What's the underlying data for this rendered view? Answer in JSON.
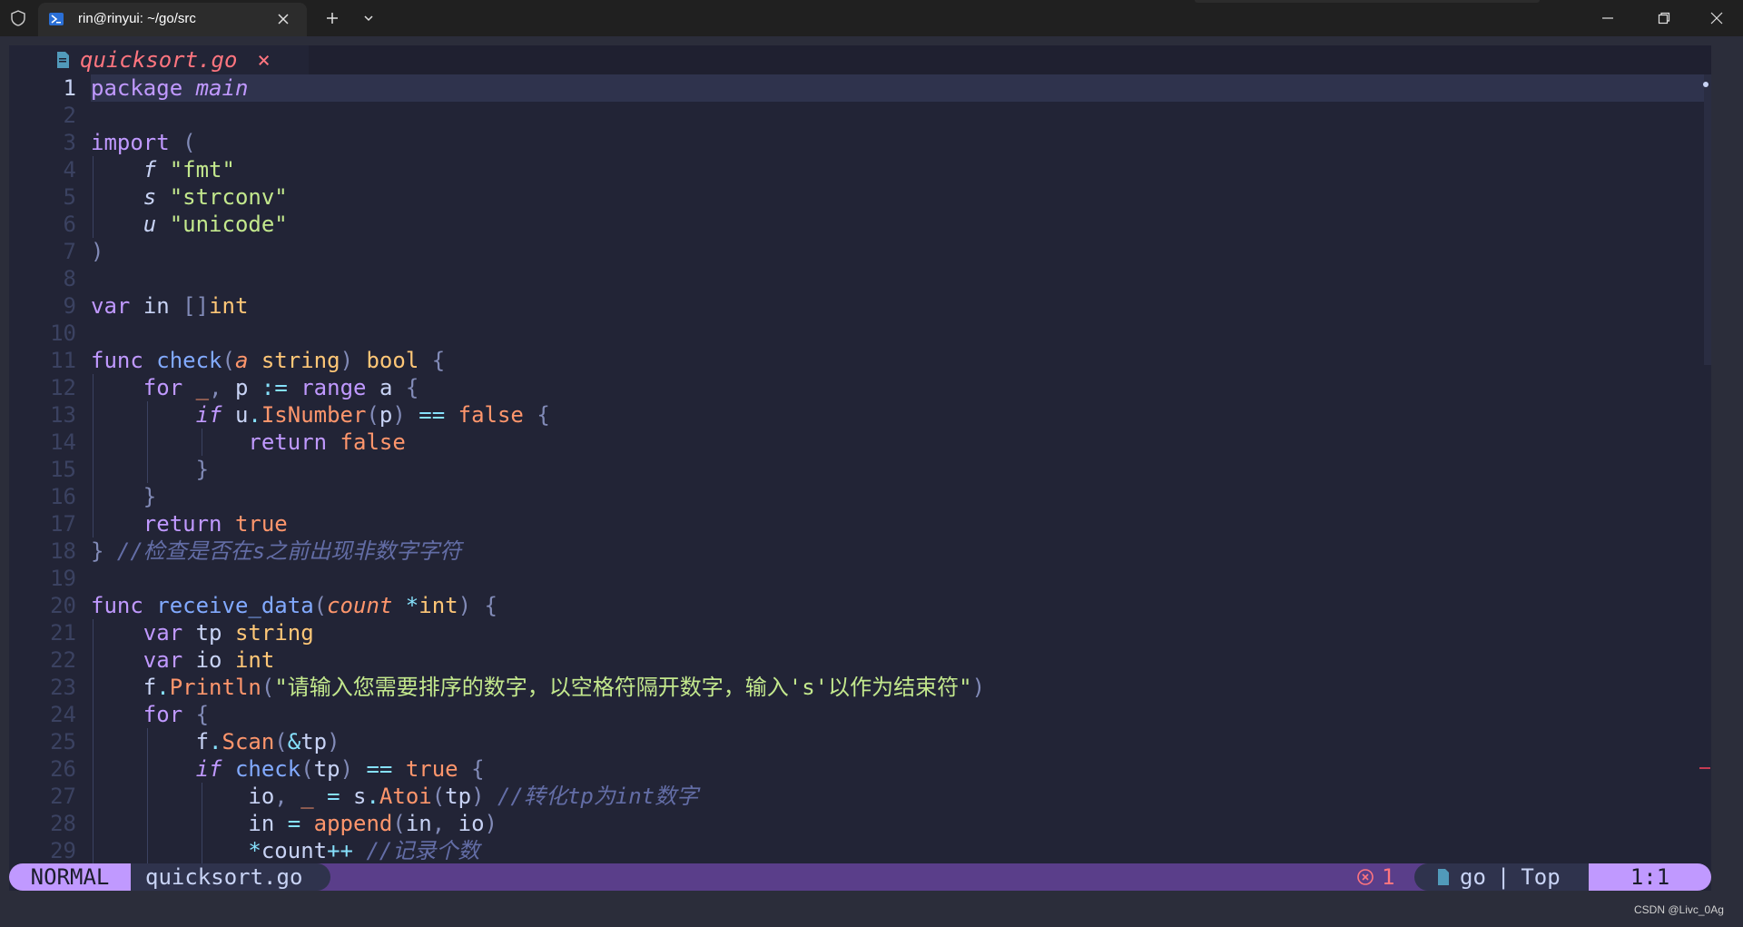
{
  "window": {
    "tab_title": "rin@rinyui: ~/go/src"
  },
  "buffer": {
    "file_name": "quicksort.go",
    "close_glyph": "×"
  },
  "line_numbers": [
    "1",
    "2",
    "3",
    "4",
    "5",
    "6",
    "7",
    "8",
    "9",
    "10",
    "11",
    "12",
    "13",
    "14",
    "15",
    "16",
    "17",
    "18",
    "19",
    "20",
    "21",
    "22",
    "23",
    "24",
    "25",
    "26",
    "27",
    "28",
    "29"
  ],
  "code": {
    "l1": {
      "a": "package",
      "b": "main"
    },
    "l3": {
      "a": "import",
      "b": "("
    },
    "l4": {
      "a": "f",
      "b": "\"fmt\""
    },
    "l5": {
      "a": "s",
      "b": "\"strconv\""
    },
    "l6": {
      "a": "u",
      "b": "\"unicode\""
    },
    "l7": {
      "a": ")"
    },
    "l9": {
      "a": "var",
      "b": "in",
      "c": "[]",
      "d": "int"
    },
    "l11": {
      "a": "func",
      "b": "check",
      "c": "(",
      "d": "a",
      "e": "string",
      "f": ")",
      "g": "bool",
      "h": "{"
    },
    "l12": {
      "a": "for",
      "b": "_",
      "c": ",",
      "d": "p",
      "e": ":=",
      "f": "range",
      "g": "a",
      "h": "{"
    },
    "l13": {
      "a": "if",
      "b": "u",
      "c": ".",
      "d": "IsNumber",
      "e": "(",
      "f": "p",
      "g": ")",
      "h": "==",
      "i": "false",
      "j": "{"
    },
    "l14": {
      "a": "return",
      "b": "false"
    },
    "l15": {
      "a": "}"
    },
    "l16": {
      "a": "}"
    },
    "l17": {
      "a": "return",
      "b": "true"
    },
    "l18": {
      "a": "}",
      "b": "//检查是否在s之前出现非数字字符"
    },
    "l20": {
      "a": "func",
      "b": "receive_data",
      "c": "(",
      "d": "count",
      "e": "*",
      "f": "int",
      "g": ")",
      "h": "{"
    },
    "l21": {
      "a": "var",
      "b": "tp",
      "c": "string"
    },
    "l22": {
      "a": "var",
      "b": "io",
      "c": "int"
    },
    "l23": {
      "a": "f",
      "b": ".",
      "c": "Println",
      "d": "(",
      "e": "\"请输入您需要排序的数字，以空格符隔开数字，输入's'以作为结束符\"",
      "f": ")"
    },
    "l24": {
      "a": "for",
      "b": "{"
    },
    "l25": {
      "a": "f",
      "b": ".",
      "c": "Scan",
      "d": "(",
      "e": "&",
      "f": "tp",
      "g": ")"
    },
    "l26": {
      "a": "if",
      "b": "check",
      "c": "(",
      "d": "tp",
      "e": ")",
      "f": "==",
      "g": "true",
      "h": "{"
    },
    "l27": {
      "a": "io",
      "b": ",",
      "c": "_",
      "d": "=",
      "e": "s",
      "f": ".",
      "g": "Atoi",
      "h": "(",
      "i": "tp",
      "j": ")",
      "k": "//转化tp为int数字"
    },
    "l28": {
      "a": "in",
      "b": "=",
      "c": "append",
      "d": "(",
      "e": "in",
      "f": ",",
      "g": "io",
      "h": ")"
    },
    "l29": {
      "a": "*",
      "b": "count",
      "c": "++",
      "d": "//记录个数"
    }
  },
  "statusline": {
    "mode": "NORMAL",
    "file": "quicksort.go",
    "errors": "1",
    "filetype": "go",
    "separator": "|",
    "scroll": "Top",
    "position": "1:1"
  },
  "watermark": "CSDN @Livc_0Ag",
  "colors": {
    "background": "#222436",
    "keyword": "#c099ff",
    "function": "#82aaff",
    "type": "#ffc777",
    "string": "#c3e88d",
    "comment": "#636da6",
    "accent": "#c099ff",
    "error": "#ff757f"
  },
  "icons": [
    "shield-icon",
    "powershell-icon",
    "close-icon",
    "plus-icon",
    "chevron-down-icon",
    "minimize-icon",
    "maximize-icon",
    "window-close-icon",
    "go-file-icon",
    "error-circle-icon"
  ]
}
